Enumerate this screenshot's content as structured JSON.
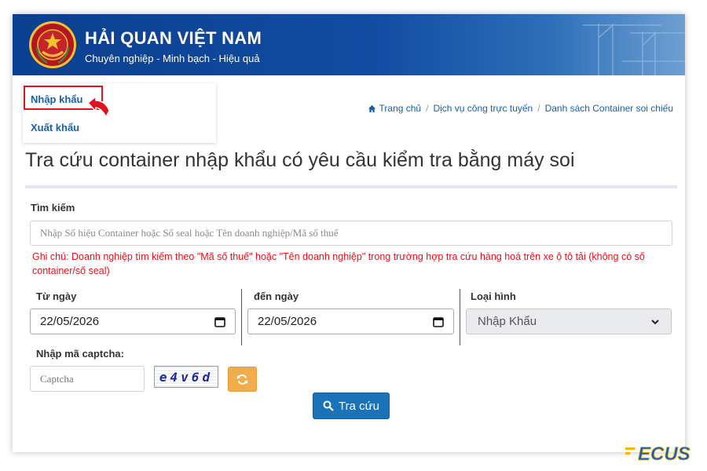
{
  "header": {
    "title": "HẢI QUAN VIỆT NAM",
    "slogan": "Chuyên nghiệp - Minh bạch - Hiệu quả",
    "logo_icon": "vietnam-customs-emblem-icon"
  },
  "sidebar": {
    "items": [
      {
        "label": "Nhập khẩu",
        "highlighted": true
      },
      {
        "label": "Xuất khẩu",
        "highlighted": false
      }
    ],
    "pointer_icon": "hand-pointer-icon"
  },
  "breadcrumb": {
    "items": [
      "Trang chủ",
      "Dịch vụ công trực tuyến",
      "Danh sách Container soi chiếu"
    ],
    "separator": "/"
  },
  "page_title": "Tra cứu container nhập khẩu có yêu cầu kiểm tra bằng máy soi",
  "search": {
    "label": "Tìm kiếm",
    "placeholder": "Nhập Số hiệu Container hoặc Số seal hoặc Tên doanh nghiệp/Mã số thuế",
    "note": "Ghi chú: Doanh nghiệp tìm kiếm theo \"Mã số thuế\" hoặc \"Tên doanh nghiệp\" trong trường hợp tra cứu hàng hoá trên xe ô tô tải (không có số container/số seal)"
  },
  "from_date": {
    "label": "Từ ngày",
    "value": "22/05/2026"
  },
  "to_date": {
    "label": "đến ngày",
    "value": "22/05/2026"
  },
  "type": {
    "label": "Loại hình",
    "value": "Nhập Khẩu"
  },
  "captcha": {
    "label": "Nhập mã captcha:",
    "placeholder": "Captcha",
    "image_text": "e4v6d"
  },
  "buttons": {
    "search_label": "Tra cứu"
  },
  "watermark": {
    "text": "ECUS"
  },
  "colors": {
    "header_blue": "#0b3f8f",
    "link_blue": "#1a5fa8",
    "note_red": "#e0121b",
    "refresh_orange": "#f0ad4e",
    "search_button_blue": "#1a73b8"
  }
}
